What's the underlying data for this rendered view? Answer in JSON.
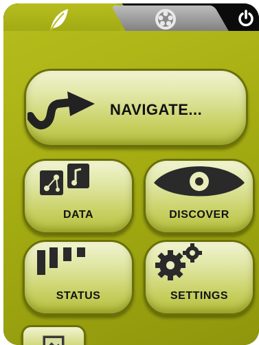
{
  "tabs": [
    {
      "name": "leaf-tab",
      "icon": "leaf-icon",
      "active": true
    },
    {
      "name": "film-tab",
      "icon": "film-reel-icon",
      "active": false
    }
  ],
  "power": {
    "icon": "power-icon"
  },
  "buttons": {
    "navigate": {
      "label": "NAVIGATE...",
      "icon": "route-arrow-icon"
    },
    "data": {
      "label": "DATA",
      "icon": "data-files-icon"
    },
    "discover": {
      "label": "DISCOVER",
      "icon": "eye-icon"
    },
    "status": {
      "label": "STATUS",
      "icon": "signal-bars-icon"
    },
    "settings": {
      "label": "SETTINGS",
      "icon": "gears-icon"
    },
    "map": {
      "icon": "map-image-icon"
    }
  },
  "colors": {
    "panel": "#a4ac12",
    "button": "#dfe5a0",
    "text": "#111111"
  }
}
